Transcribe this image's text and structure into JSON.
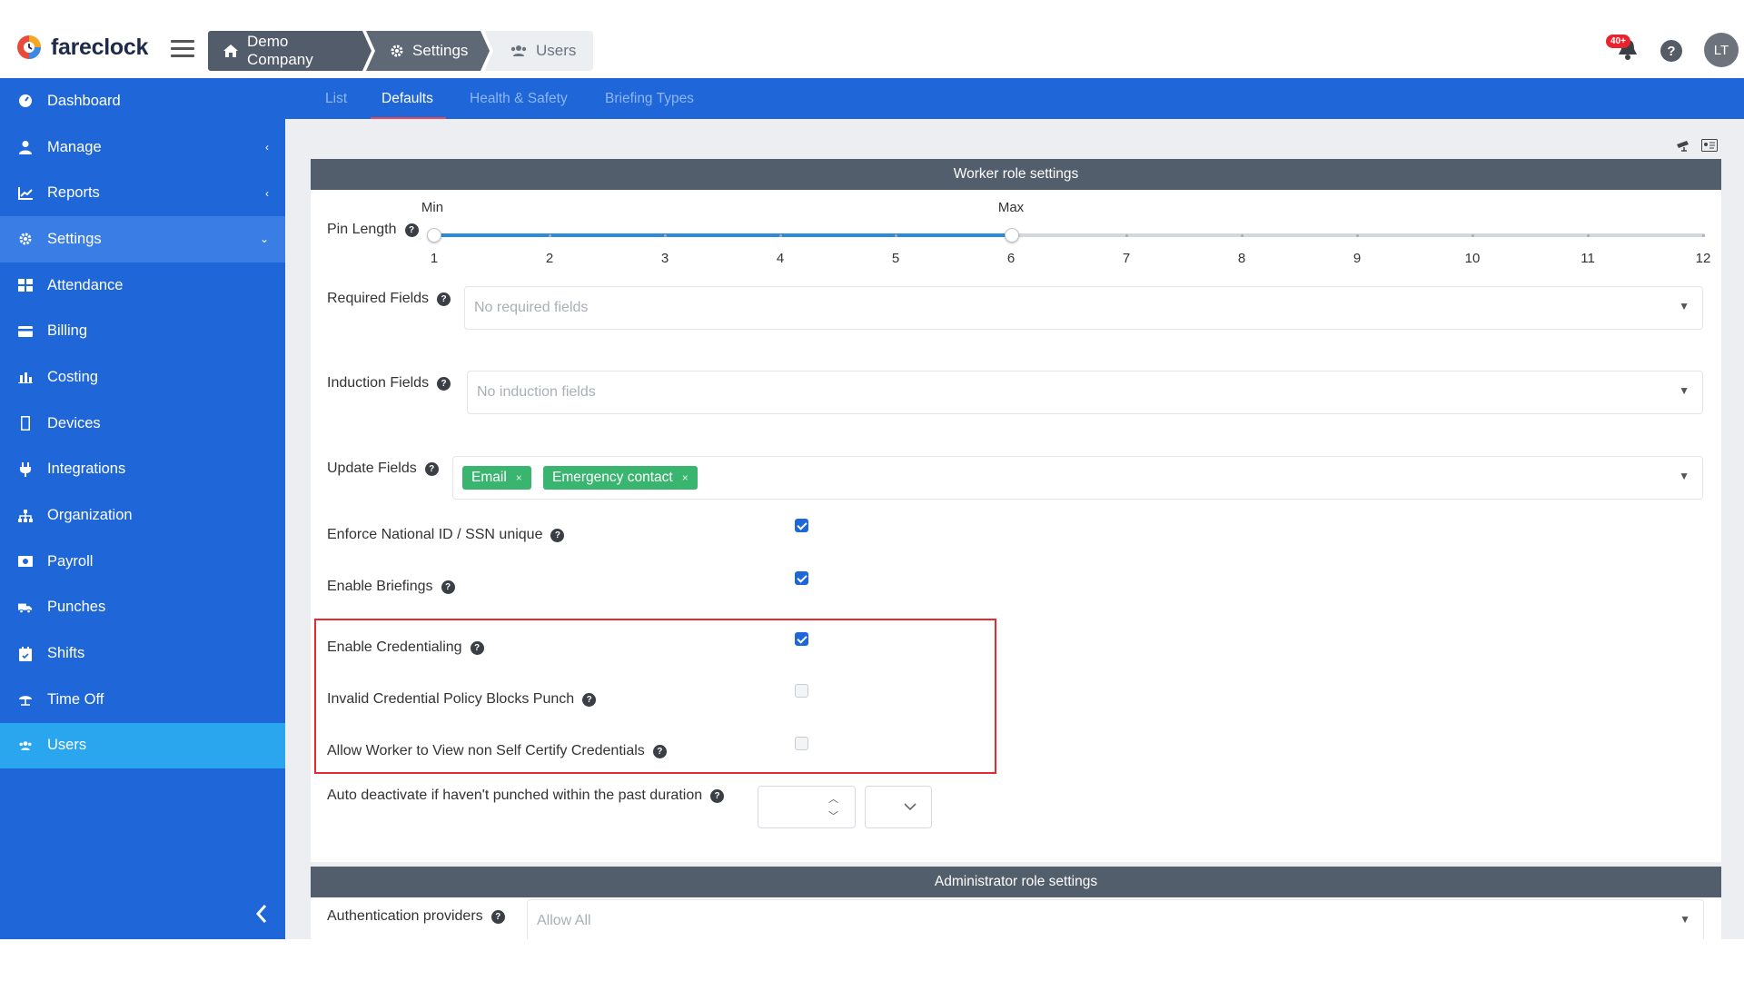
{
  "app": {
    "brand": "fareclock"
  },
  "breadcrumb": [
    "Demo Company",
    "Settings",
    "Users"
  ],
  "notifications": {
    "badge": "40+"
  },
  "help_label": "?",
  "user": {
    "initials": "LT"
  },
  "sidebar": {
    "items": [
      {
        "label": "Dashboard",
        "icon": "dashboard-icon"
      },
      {
        "label": "Manage",
        "icon": "user-icon",
        "chevron": "‹"
      },
      {
        "label": "Reports",
        "icon": "line-chart-icon",
        "chevron": "‹"
      },
      {
        "label": "Settings",
        "icon": "gear-icon",
        "chevron": "⌄"
      },
      {
        "label": "Attendance",
        "icon": "attendance-icon"
      },
      {
        "label": "Billing",
        "icon": "credit-card-icon"
      },
      {
        "label": "Costing",
        "icon": "bar-chart-icon"
      },
      {
        "label": "Devices",
        "icon": "mobile-icon"
      },
      {
        "label": "Integrations",
        "icon": "plug-icon"
      },
      {
        "label": "Organization",
        "icon": "sitemap-icon"
      },
      {
        "label": "Payroll",
        "icon": "money-icon"
      },
      {
        "label": "Punches",
        "icon": "truck-icon"
      },
      {
        "label": "Shifts",
        "icon": "calendar-icon"
      },
      {
        "label": "Time Off",
        "icon": "umbrella-icon"
      },
      {
        "label": "Users",
        "icon": "users-icon"
      }
    ]
  },
  "tabs": [
    "List",
    "Defaults",
    "Health & Safety",
    "Briefing Types"
  ],
  "worker": {
    "header": "Worker role settings",
    "pin_length": {
      "label": "Pin Length",
      "min_label": "Min",
      "max_label": "Max",
      "min_value": 1,
      "max_value": 6,
      "ticks": [
        "1",
        "2",
        "3",
        "4",
        "5",
        "6",
        "7",
        "8",
        "9",
        "10",
        "11",
        "12"
      ]
    },
    "required_fields": {
      "label": "Required Fields",
      "placeholder": "No required fields"
    },
    "induction_fields": {
      "label": "Induction Fields",
      "placeholder": "No induction fields"
    },
    "update_fields": {
      "label": "Update Fields",
      "chips": [
        "Email",
        "Emergency contact"
      ],
      "chip_remove": "×"
    },
    "enforce_national_id": {
      "label": "Enforce National ID / SSN unique",
      "checked": true
    },
    "enable_briefings": {
      "label": "Enable Briefings",
      "checked": true
    },
    "enable_credentialing": {
      "label": "Enable Credentialing",
      "checked": true
    },
    "invalid_credential_policy": {
      "label": "Invalid Credential Policy Blocks Punch",
      "checked": false
    },
    "allow_worker_view": {
      "label": "Allow Worker to View non Self Certify Credentials",
      "checked": false
    },
    "auto_deactivate": {
      "label": "Auto deactivate if haven't punched within the past duration",
      "value": ""
    }
  },
  "admin": {
    "header": "Administrator role settings",
    "auth_providers": {
      "label": "Authentication providers",
      "placeholder": "Allow All"
    }
  }
}
